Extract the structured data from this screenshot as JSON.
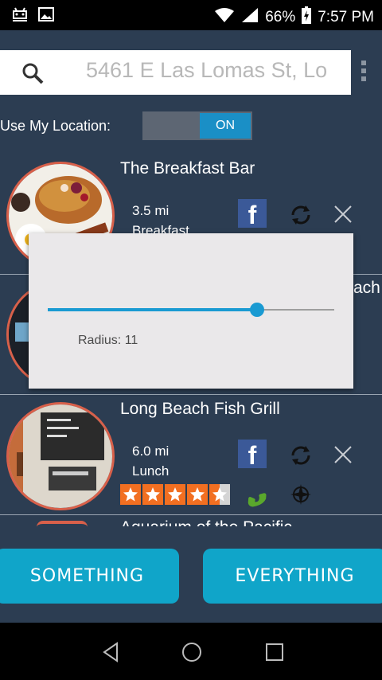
{
  "status_bar": {
    "battery": "66%",
    "time": "7:57 PM"
  },
  "search": {
    "value": "5461 E Las Lomas St, Lo",
    "icon": "search-icon"
  },
  "location": {
    "label": "Use My Location:",
    "toggle_state": "ON"
  },
  "items": [
    {
      "title": "The Breakfast Bar",
      "distance": "3.5 mi",
      "category": "Breakfast"
    },
    {
      "title_partial": "ach"
    },
    {
      "title": "Long Beach Fish Grill",
      "distance": "6.0 mi",
      "category": "Lunch",
      "rating": 4.5
    },
    {
      "title_partial": "Aquarium of the Pacific"
    }
  ],
  "dialog": {
    "label": "Radius: 11",
    "slider_fraction": 0.73
  },
  "buttons": {
    "something": "SOMETHING",
    "everything": "EVERYTHING"
  },
  "colors": {
    "accent": "#10a5c9",
    "background": "#2c3d52",
    "facebook": "#3b5998",
    "star": "#f26f21",
    "thumb_border": "#d8604a"
  }
}
